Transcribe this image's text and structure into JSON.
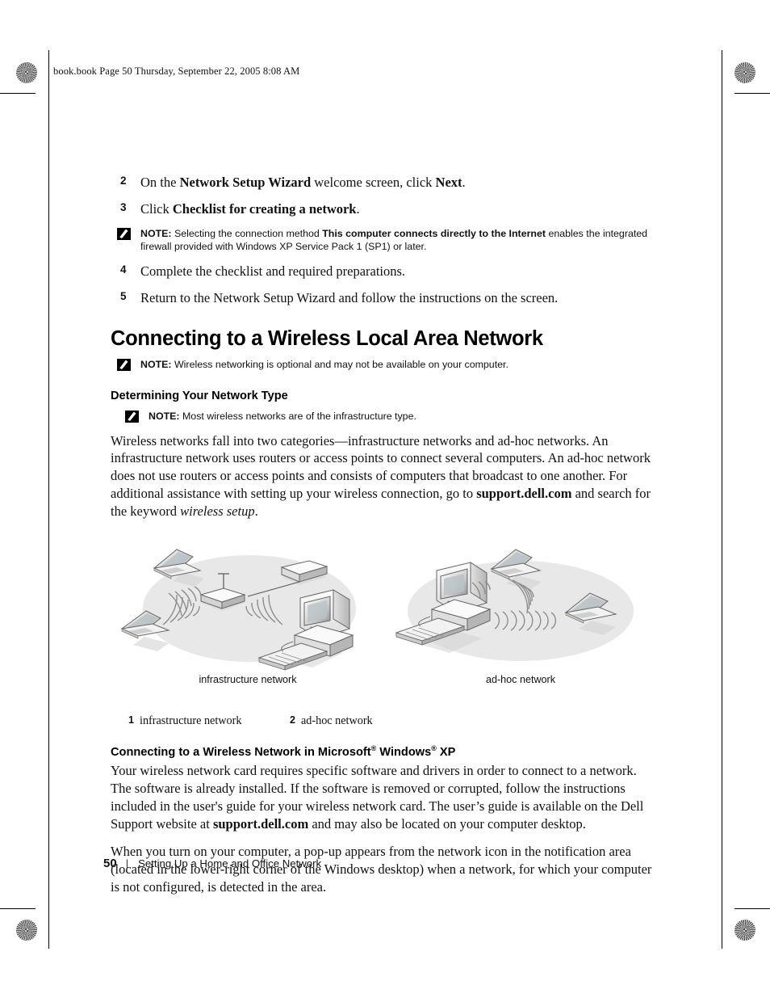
{
  "header": {
    "file_line": "book.book  Page 50  Thursday, September 22, 2005  8:08 AM"
  },
  "steps": [
    {
      "num": "2",
      "parts": [
        {
          "t": "On the ",
          "b": false
        },
        {
          "t": "Network Setup Wizard",
          "b": true
        },
        {
          "t": " welcome screen, click ",
          "b": false
        },
        {
          "t": "Next",
          "b": true
        },
        {
          "t": ".",
          "b": false
        }
      ]
    },
    {
      "num": "3",
      "parts": [
        {
          "t": "Click ",
          "b": false
        },
        {
          "t": "Checklist for creating a network",
          "b": true
        },
        {
          "t": ".",
          "b": false
        }
      ]
    }
  ],
  "note_firewall": {
    "label": "NOTE:",
    "parts": [
      {
        "t": " Selecting the connection method ",
        "b": false
      },
      {
        "t": "This computer connects directly to the Internet",
        "b": true
      },
      {
        "t": " enables the integrated firewall provided with Windows XP Service Pack 1 (SP1) or later.",
        "b": false
      }
    ]
  },
  "steps_after": [
    {
      "num": "4",
      "parts": [
        {
          "t": "Complete the checklist and required preparations.",
          "b": false
        }
      ]
    },
    {
      "num": "5",
      "parts": [
        {
          "t": "Return to the Network Setup Wizard and follow the instructions on the screen.",
          "b": false
        }
      ]
    }
  ],
  "section": {
    "title": "Connecting to a Wireless Local Area Network"
  },
  "note_wireless_optional": {
    "label": "NOTE:",
    "text": " Wireless networking is optional and may not be available on your computer."
  },
  "subsection_network_type": {
    "title": "Determining Your Network Type"
  },
  "note_infrastructure": {
    "label": "NOTE:",
    "text": " Most wireless networks are of the infrastructure type."
  },
  "paragraph_network_types": {
    "parts": [
      {
        "t": "Wireless networks fall into two categories—infrastructure networks and ad-hoc networks. An infrastructure network uses routers or access points to connect several computers. An ad-hoc network does not use routers or access points and consists of computers that broadcast to one another. For additional assistance with setting up your wireless connection, go to ",
        "b": false,
        "i": false
      },
      {
        "t": "support.dell.com",
        "b": true,
        "i": false
      },
      {
        "t": " and search for the keyword ",
        "b": false,
        "i": false
      },
      {
        "t": "wireless setup",
        "b": false,
        "i": true
      },
      {
        "t": ".",
        "b": false,
        "i": false
      }
    ]
  },
  "figure": {
    "caption_left": "infrastructure network",
    "caption_right": "ad-hoc network",
    "legend": [
      {
        "num": "1",
        "text": "infrastructure network"
      },
      {
        "num": "2",
        "text": "ad-hoc network"
      }
    ]
  },
  "subsection_winxp": {
    "prefix": "Connecting to a Wireless Network in Microsoft",
    "reg1": "®",
    "middle": " Windows",
    "reg2": "®",
    "suffix": " XP"
  },
  "paragraph_card": {
    "parts": [
      {
        "t": "Your wireless network card requires specific software and drivers in order to connect to a network. The software is already installed. If the software is removed or corrupted, follow the instructions included in the user's guide for your wireless network card. The user’s guide is available on the Dell Support website at ",
        "b": false
      },
      {
        "t": "support.dell.com",
        "b": true
      },
      {
        "t": " and may also be located on your computer desktop.",
        "b": false
      }
    ]
  },
  "paragraph_popup": {
    "parts": [
      {
        "t": "When you turn on your computer, a pop-up appears from the network icon in the notification area (located in the lower-right corner of the Windows desktop) when a network, for which your computer is not configured, is detected in the area.",
        "b": false
      }
    ]
  },
  "footer": {
    "page_number": "50",
    "separator": "|",
    "chapter": "Setting Up a Home and Office Network"
  },
  "colors": {
    "text": "#111111",
    "diagram_ellipse": "#e8e8e8",
    "device_light": "#fbfbfb",
    "device_mid": "#d8d8d8",
    "device_dark": "#9a9a9a",
    "outline": "#555555"
  }
}
